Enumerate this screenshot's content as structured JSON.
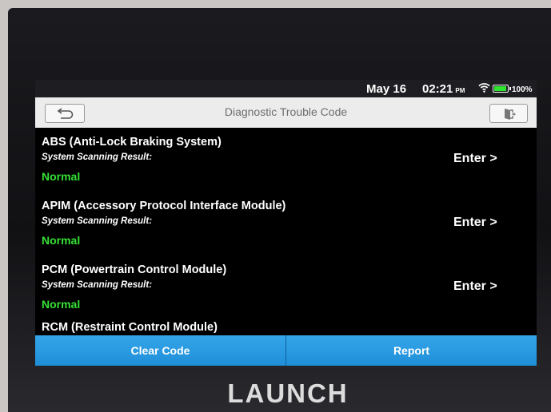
{
  "status_bar": {
    "date": "May 16",
    "time": "02:21",
    "ampm": "PM",
    "battery_pct": "100%",
    "battery_level": 1.0,
    "battery_color": "#2fe62f"
  },
  "header": {
    "title": "Diagnostic Trouble Code"
  },
  "systems": [
    {
      "name": "ABS (Anti-Lock Braking System)",
      "result_label": "System Scanning Result:",
      "status": "Normal",
      "action": "Enter >"
    },
    {
      "name": "APIM (Accessory Protocol Interface Module)",
      "result_label": "System Scanning Result:",
      "status": "Normal",
      "action": "Enter >"
    },
    {
      "name": "PCM (Powertrain Control Module)",
      "result_label": "System Scanning Result:",
      "status": "Normal",
      "action": "Enter >"
    },
    {
      "name": "RCM (Restraint Control Module)"
    }
  ],
  "footer": {
    "clear_label": "Clear Code",
    "report_label": "Report"
  },
  "device": {
    "brand": "LAUNCH"
  },
  "colors": {
    "accent": "#2a9be2",
    "status_normal": "#35e135"
  }
}
